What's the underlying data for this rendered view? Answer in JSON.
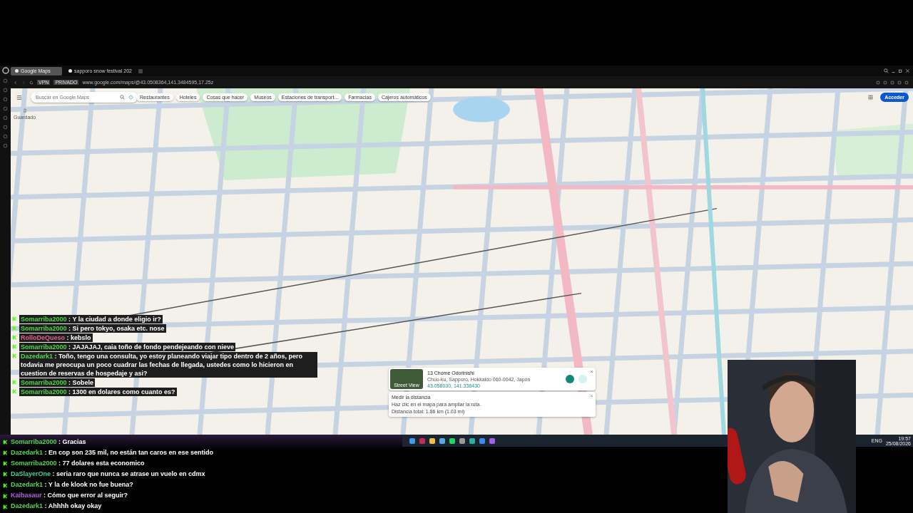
{
  "browser": {
    "tabs": [
      {
        "label": "Google Maps",
        "selected": true
      },
      {
        "label": "sapporo snow festival 202",
        "selected": false
      }
    ],
    "badges": [
      "VPN",
      "PRIVADO"
    ],
    "address": "www.google.com/maps/@43.0508364,141.3484595,17.25z"
  },
  "maps": {
    "search": {
      "placeholder": "Buscar en Google Maps"
    },
    "saved_label": "Guardado",
    "chips": [
      "Restaurantes",
      "Hoteles",
      "Cosas que hacer",
      "Museos",
      "Estaciones de transport...",
      "Farmacias",
      "Cajeros automáticos"
    ],
    "sign_in": "Acceder",
    "place_card": {
      "thumb_label": "Street View",
      "title": "13 Chome Odorinishi",
      "address": "Chuo-ku, Sapporo, Hokkaido 060-0042, Japón",
      "coords": "43.058030, 141.336430"
    },
    "measure_card": {
      "title": "Medir la distancia",
      "hint": "Haz clic en el mapa para ampliar la ruta.",
      "total": "Distancia total: 1.86 km (1.03 mi)"
    }
  },
  "chat_overlay": [
    {
      "user": "Somarriba2000",
      "text": ": Y la ciudad a donde eligio ir?",
      "color": "#4fd84a"
    },
    {
      "user": "Somarriba2000",
      "text": ": Si pero tokyo, osaka etc. nose",
      "color": "#4fd84a"
    },
    {
      "user": "RolloDeQueso",
      "text": ": kebslo",
      "color": "#e0608a"
    },
    {
      "user": "Somarriba2000",
      "text": ": JAJAJAJ, caia toño de fondo pendejeando con nieve",
      "color": "#4fd84a"
    },
    {
      "user": "Dazedark1",
      "text": ": Toño, tengo una consulta, yo estoy planeando viajar tipo dentro de 2 años, pero todavia me preocupa un poco cuadrar las fechas de llegada, ustedes como lo hicieron en cuestion de reservas de hospedaje y asi?",
      "color": "#4fd84a"
    },
    {
      "user": "Somarriba2000",
      "text": ": Sobele",
      "color": "#4fd84a"
    },
    {
      "user": "Somarriba2000",
      "text": ": 1300 en dolares como cuanto es?",
      "color": "#4fd84a"
    }
  ],
  "chat": [
    {
      "user": "Somarriba2000",
      "text": ": Gracias",
      "color": "#4fd84a"
    },
    {
      "user": "Dazedark1",
      "text": ": En cop son 235 mil, no están tan caros en ese sentido",
      "color": "#4fd84a"
    },
    {
      "user": "Somarriba2000",
      "text": ": 77 dolares esta economico",
      "color": "#4fd84a"
    },
    {
      "user": "DaSlayerOne",
      "text": ": seria raro que nunca se atrase un vuelo en cdmx",
      "color": "#3fd0a0"
    },
    {
      "user": "Dazedark1",
      "text": ": Y la de klook no fue buena?",
      "color": "#4fd84a"
    },
    {
      "user": "Kaibasaur",
      "text": ": Cómo que error al seguir?",
      "color": "#b25ee0"
    },
    {
      "user": "Dazedark1",
      "text": ": Ahhhh okay okay",
      "color": "#4fd84a"
    }
  ],
  "taskbar": {
    "language": "ENG",
    "time": "19:57",
    "date": "25/08/2026"
  }
}
